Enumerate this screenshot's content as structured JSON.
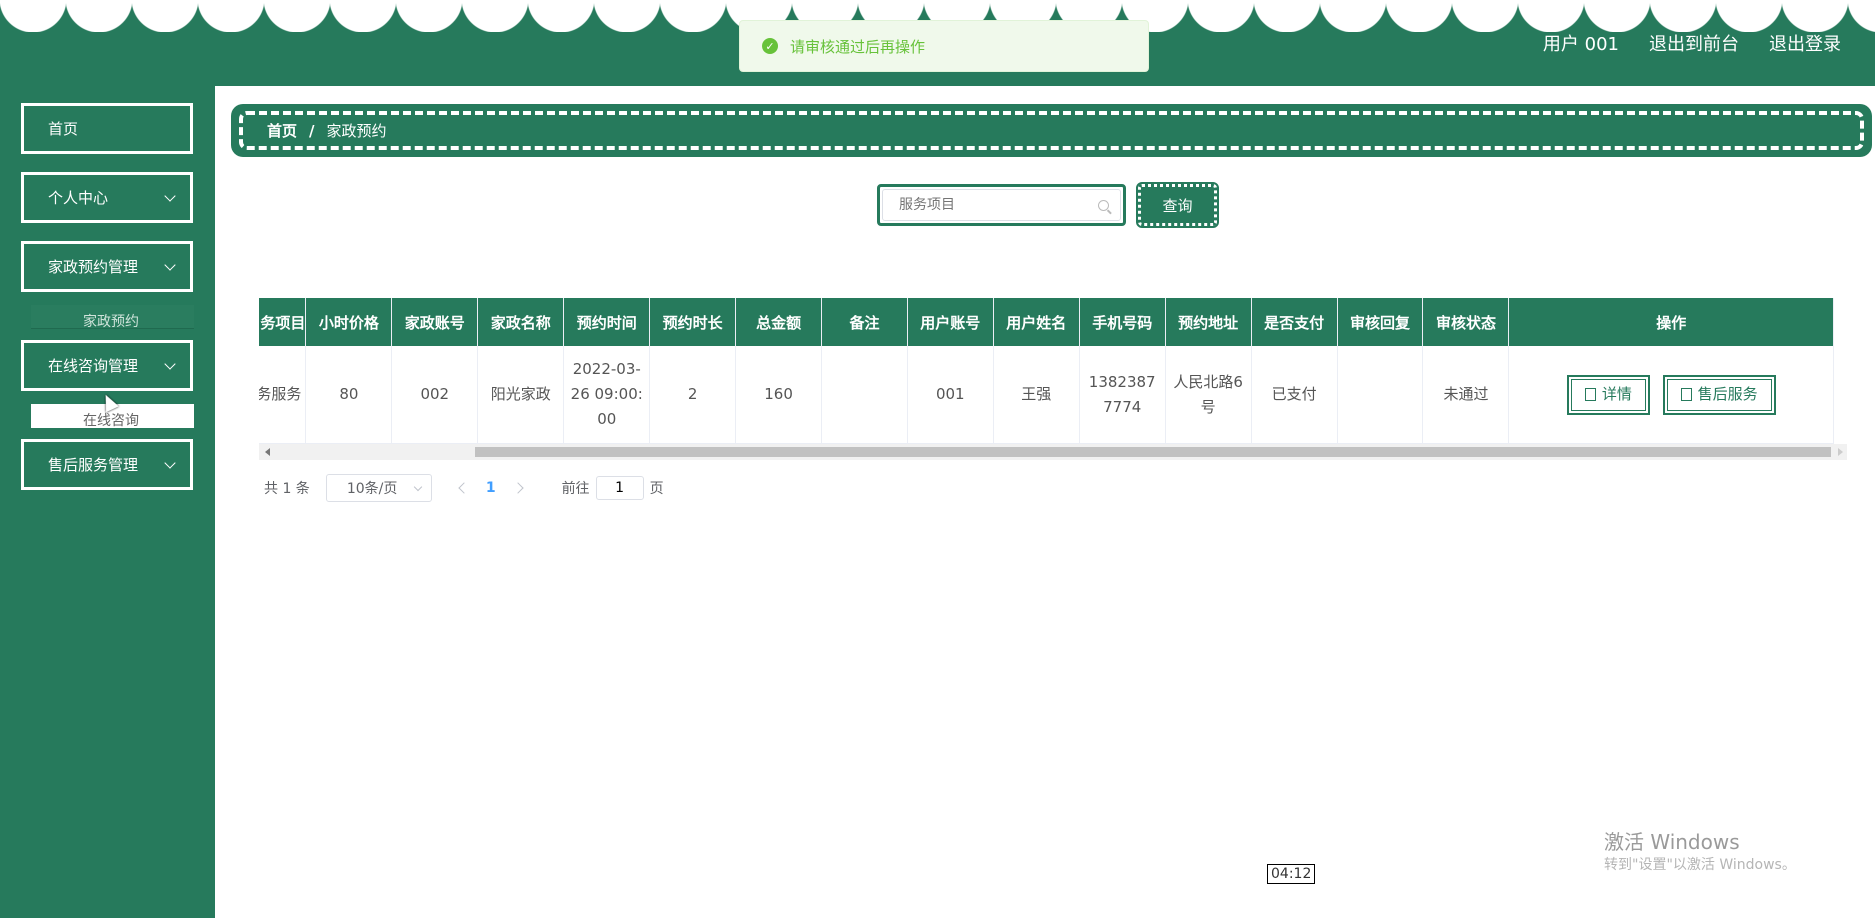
{
  "header": {
    "user_label": "用户 001",
    "front_link": "退出到前台",
    "logout_link": "退出登录"
  },
  "toast": {
    "message": "请审核通过后再操作"
  },
  "sidebar": {
    "items": [
      {
        "label": "首页"
      },
      {
        "label": "个人中心"
      },
      {
        "label": "家政预约管理",
        "sub": "家政预约"
      },
      {
        "label": "在线咨询管理",
        "sub": "在线咨询"
      },
      {
        "label": "售后服务管理"
      }
    ]
  },
  "breadcrumb": {
    "home": "首页",
    "separator": "/",
    "current": "家政预约"
  },
  "search": {
    "placeholder": "服务项目",
    "button": "查询"
  },
  "table": {
    "columns": [
      "务项目",
      "小时价格",
      "家政账号",
      "家政名称",
      "预约时间",
      "预约时长",
      "总金额",
      "备注",
      "用户账号",
      "用户姓名",
      "手机号码",
      "预约地址",
      "是否支付",
      "审核回复",
      "审核状态",
      "操作"
    ],
    "rows": [
      {
        "service": "务服务",
        "hourly_price": "80",
        "housekeeper_account": "002",
        "housekeeper_name": "阳光家政",
        "appointment_time": "2022-03-26 09:00:00",
        "duration": "2",
        "total": "160",
        "remark": "",
        "user_account": "001",
        "user_name": "王强",
        "phone": "13823877774",
        "address": "人民北路6号",
        "paid": "已支付",
        "review_reply": "",
        "review_status": "未通过",
        "btn_detail": "详情",
        "btn_aftersale": "售后服务"
      }
    ]
  },
  "pagination": {
    "total": "共 1 条",
    "page_size": "10条/页",
    "current_page": "1",
    "goto_prefix": "前往",
    "goto_value": "1",
    "goto_suffix": "页"
  },
  "overlay": {
    "timestamp": "04:12",
    "watermark": "激活 Windows",
    "watermark_sub": "转到\"设置\"以激活 Windows。"
  }
}
